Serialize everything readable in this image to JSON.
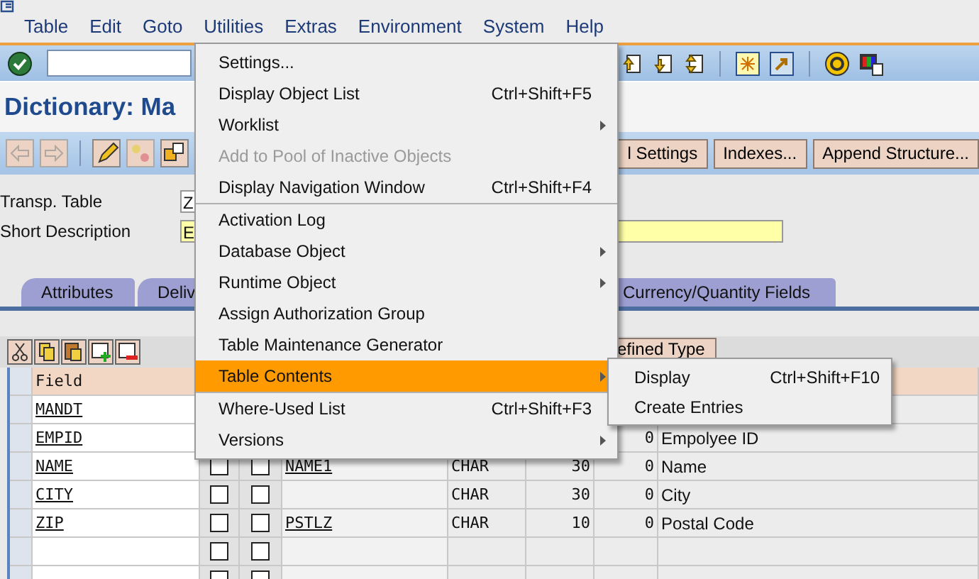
{
  "menubar": [
    "Table",
    "Edit",
    "Goto",
    "Utilities",
    "Extras",
    "Environment",
    "System",
    "Help"
  ],
  "title": "Dictionary: Ma",
  "app_buttons": [
    "l Settings",
    "Indexes...",
    "Append Structure..."
  ],
  "fields": [
    {
      "label": "Transp. Table",
      "value": "Z",
      "kind": "plain"
    },
    {
      "label": "Short Description",
      "value": "E",
      "kind": "required"
    }
  ],
  "tabs": [
    {
      "label": "Attributes",
      "selected": false
    },
    {
      "label": "Deliv",
      "selected": false
    },
    {
      "label": "Currency/Quantity Fields",
      "selected": false
    }
  ],
  "table_button": "efined Type",
  "table": {
    "columns": [
      "Field"
    ],
    "rows": [
      {
        "field": "MANDT"
      },
      {
        "field": "EMPID",
        "decimals": "0",
        "description": "Empolyee ID"
      },
      {
        "field": "NAME",
        "key": false,
        "initial": false,
        "data_element": "NAME1",
        "type": "CHAR",
        "length": "30",
        "decimals": "0",
        "description": "Name"
      },
      {
        "field": "CITY",
        "key": false,
        "initial": false,
        "type": "CHAR",
        "length": "30",
        "decimals": "0",
        "description": "City"
      },
      {
        "field": "ZIP",
        "key": false,
        "initial": false,
        "data_element": "PSTLZ",
        "type": "CHAR",
        "length": "10",
        "decimals": "0",
        "description": "Postal Code"
      },
      {
        "key": false,
        "initial": false
      },
      {
        "key": false,
        "initial": false
      }
    ]
  },
  "menu": {
    "groups": [
      [
        {
          "label": "Settings...",
          "disabled": false,
          "selected": false,
          "submenu": false
        },
        {
          "label": "Display Object List",
          "shortcut": "Ctrl+Shift+F5",
          "disabled": false,
          "selected": false,
          "submenu": false
        },
        {
          "label": "Worklist",
          "disabled": false,
          "selected": false,
          "submenu": true
        },
        {
          "label": "Add to Pool of Inactive Objects",
          "disabled": true,
          "selected": false,
          "submenu": false
        },
        {
          "label": "Display Navigation Window",
          "shortcut": "Ctrl+Shift+F4",
          "disabled": false,
          "selected": false,
          "submenu": false
        }
      ],
      [
        {
          "label": "Activation Log",
          "disabled": false,
          "selected": false,
          "submenu": false
        },
        {
          "label": "Database Object",
          "disabled": false,
          "selected": false,
          "submenu": true
        },
        {
          "label": "Runtime Object",
          "disabled": false,
          "selected": false,
          "submenu": true
        },
        {
          "label": "Assign Authorization Group",
          "disabled": false,
          "selected": false,
          "submenu": false
        },
        {
          "label": "Table Maintenance Generator",
          "disabled": false,
          "selected": false,
          "submenu": false
        },
        {
          "label": "Table Contents",
          "disabled": false,
          "selected": true,
          "submenu": true
        }
      ],
      [
        {
          "label": "Where-Used List",
          "shortcut": "Ctrl+Shift+F3",
          "disabled": false,
          "selected": false,
          "submenu": false
        },
        {
          "label": "Versions",
          "disabled": false,
          "selected": false,
          "submenu": true
        }
      ]
    ]
  },
  "submenu": [
    {
      "label": "Display",
      "shortcut": "Ctrl+Shift+F10",
      "selected": false
    },
    {
      "label": "Create Entries",
      "selected": false
    }
  ]
}
